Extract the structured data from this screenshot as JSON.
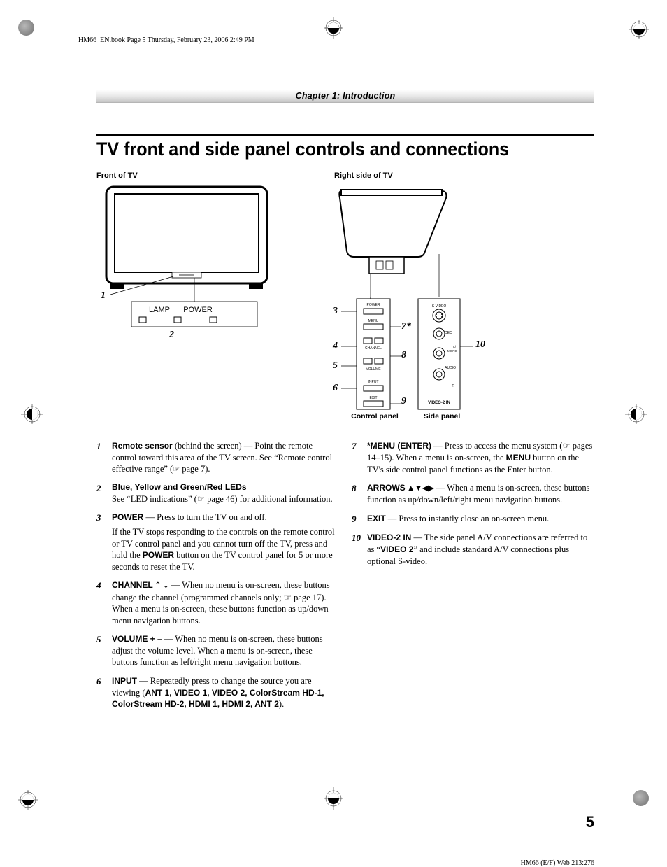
{
  "header": "HM66_EN.book  Page 5  Thursday, February 23, 2006  2:49 PM",
  "chapter": "Chapter 1: Introduction",
  "title": "TV front and side panel controls and connections",
  "diagram": {
    "front_head": "Front of TV",
    "right_head": "Right side of TV",
    "lamp": "LAMP",
    "power": "POWER",
    "control_panel": "Control panel",
    "side_panel": "Side panel",
    "cp_power": "POWER",
    "cp_menu": "MENU",
    "cp_channel": "CHANNEL",
    "cp_volume": "VOLUME",
    "cp_input": "INPUT",
    "cp_exit": "EXIT",
    "sp_svideo": "S-VIDEO",
    "sp_video": "VIDEO",
    "sp_lmono": "L/MONO",
    "sp_audio": "AUDIO",
    "sp_r": "R",
    "sp_video2in": "VIDEO-2 IN",
    "n1": "1",
    "n2": "2",
    "n3": "3",
    "n4": "4",
    "n5": "5",
    "n6": "6",
    "n7": "7*",
    "n8": "8",
    "n9": "9",
    "n10": "10"
  },
  "left_items": [
    {
      "n": "1",
      "head": "Remote sensor",
      "tail1": "  (behind the screen) — Point the remote control toward this area of the TV screen. See “Remote control effective range” (",
      "ref": "☘  page 7",
      "tail2": ")."
    },
    {
      "n": "2",
      "head": "Blue, Yellow and Green/Red LEDs",
      "body": "See “LED indications” (☞ page 46) for additional information."
    },
    {
      "n": "3",
      "head": "POWER",
      "intro": " — Press to turn the TV on and off.",
      "body_pre": "If the TV stops responding to the controls on the remote control or TV control panel and you cannot turn off the TV, press and hold the ",
      "body_bold": "POWER",
      "body_post": " button on the TV control panel for 5 or more seconds to reset the TV."
    },
    {
      "n": "4",
      "head": "CHANNEL",
      "sym": " ⌃ ⌄",
      "body": " — When no menu is on-screen, these buttons change the channel (programmed channels only; ☞ page 17). When a menu is on-screen, these buttons function as up/down menu navigation buttons."
    },
    {
      "n": "5",
      "head": "VOLUME + –",
      "body": "  — When no menu is on-screen, these buttons adjust the volume level. When a menu is on-screen, these buttons function as left/right menu navigation buttons."
    },
    {
      "n": "6",
      "head": "INPUT",
      "pre": " — Repeatedly press to change the source you are viewing (",
      "list": "ANT 1, VIDEO 1, VIDEO 2, ColorStream HD-1, ColorStream HD-2, HDMI 1, HDMI 2, ANT 2",
      "post": ")."
    }
  ],
  "right_items": [
    {
      "n": "7",
      "head": "*MENU (ENTER)",
      "pre": " — Press to access the menu system (☞ pages 14–15). When a menu is on-screen, the ",
      "bold": "MENU",
      "post": " button on the TV's side control panel functions as the Enter button."
    },
    {
      "n": "8",
      "head": "ARROWS",
      "sym": " ▲▼◀▶",
      "body": " — When a menu is on-screen, these buttons function as up/down/left/right menu navigation buttons."
    },
    {
      "n": "9",
      "head": "EXIT",
      "body": " — Press to instantly close an on-screen menu."
    },
    {
      "n": "10",
      "head": "VIDEO-2 IN",
      "pre": " — The side panel A/V connections are referred to as “",
      "bold": "VIDEO 2",
      "post": "” and include standard A/V connections plus optional S-video."
    }
  ],
  "page_num": "5",
  "footer": "HM66 (E/F) Web 213:276"
}
